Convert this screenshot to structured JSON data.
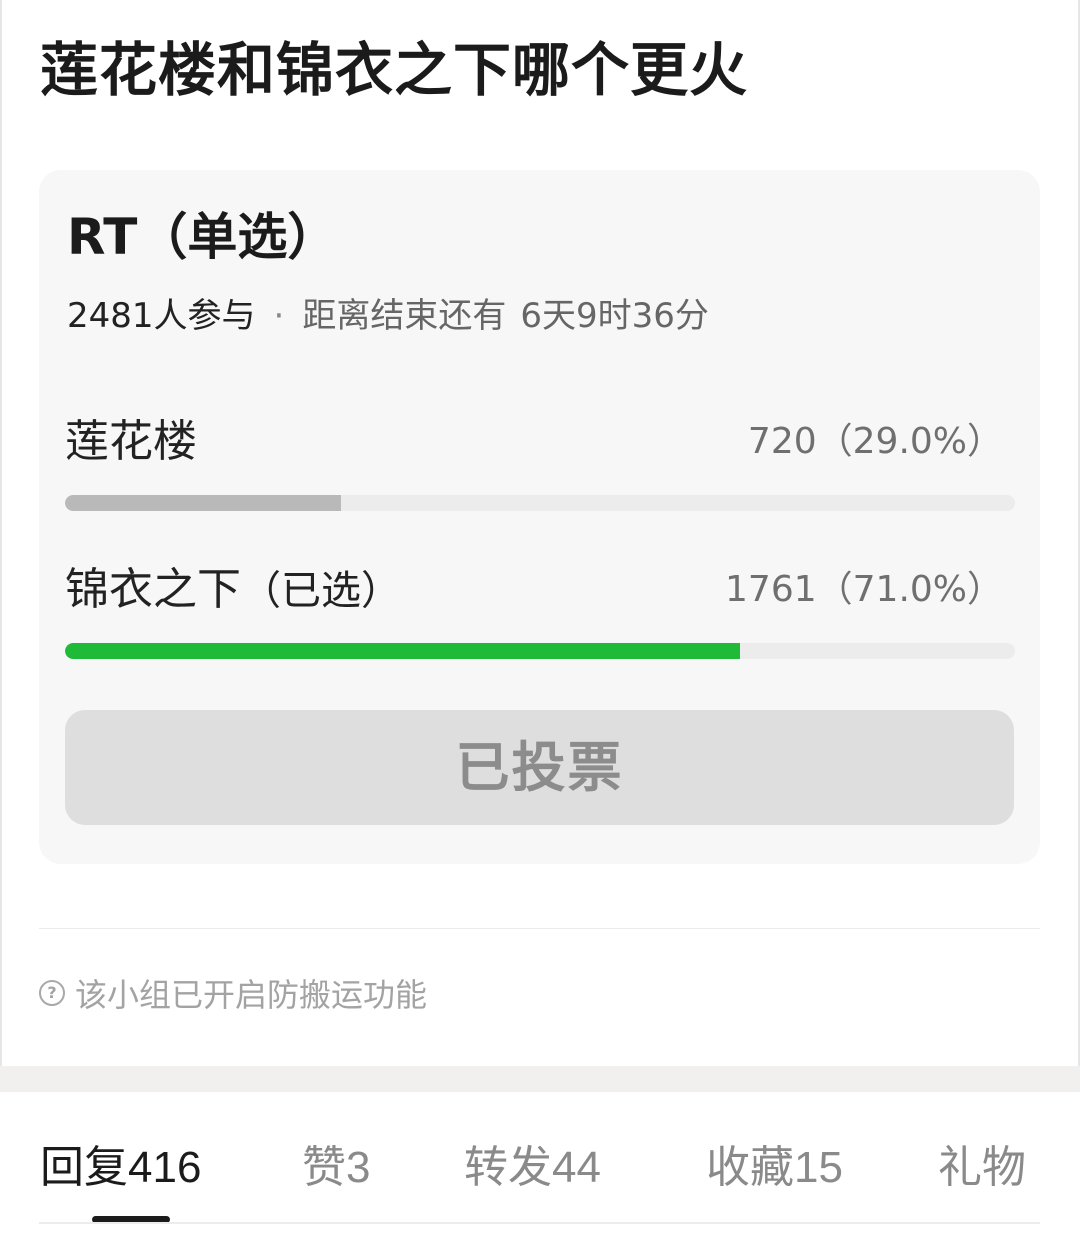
{
  "post": {
    "title": "莲花楼和锦衣之下哪个更火"
  },
  "poll": {
    "title": "RT（单选）",
    "participants": "2481人参与",
    "separator": "·",
    "deadline_label": "距离结束还有",
    "deadline_value": "6天9时36分",
    "options": [
      {
        "label": "莲花楼",
        "selected_tag": "",
        "count_text": "720（29.0%）",
        "votes": 720,
        "percent": 29.0,
        "bar_color": "#b9b9b9"
      },
      {
        "label": "锦衣之下",
        "selected_tag": "（已选）",
        "count_text": "1761（71.0%）",
        "votes": 1761,
        "percent": 71.0,
        "bar_color": "#1fbb38"
      }
    ],
    "button_label": "已投票"
  },
  "notice": {
    "icon": "help-circle-icon",
    "text": "该小组已开启防搬运功能"
  },
  "tabs": [
    {
      "label": "回复",
      "count": "416",
      "active": true
    },
    {
      "label": "赞",
      "count": "3",
      "active": false
    },
    {
      "label": "转发",
      "count": "44",
      "active": false
    },
    {
      "label": "收藏",
      "count": "15",
      "active": false
    },
    {
      "label": "礼物",
      "count": "",
      "active": false
    }
  ]
}
